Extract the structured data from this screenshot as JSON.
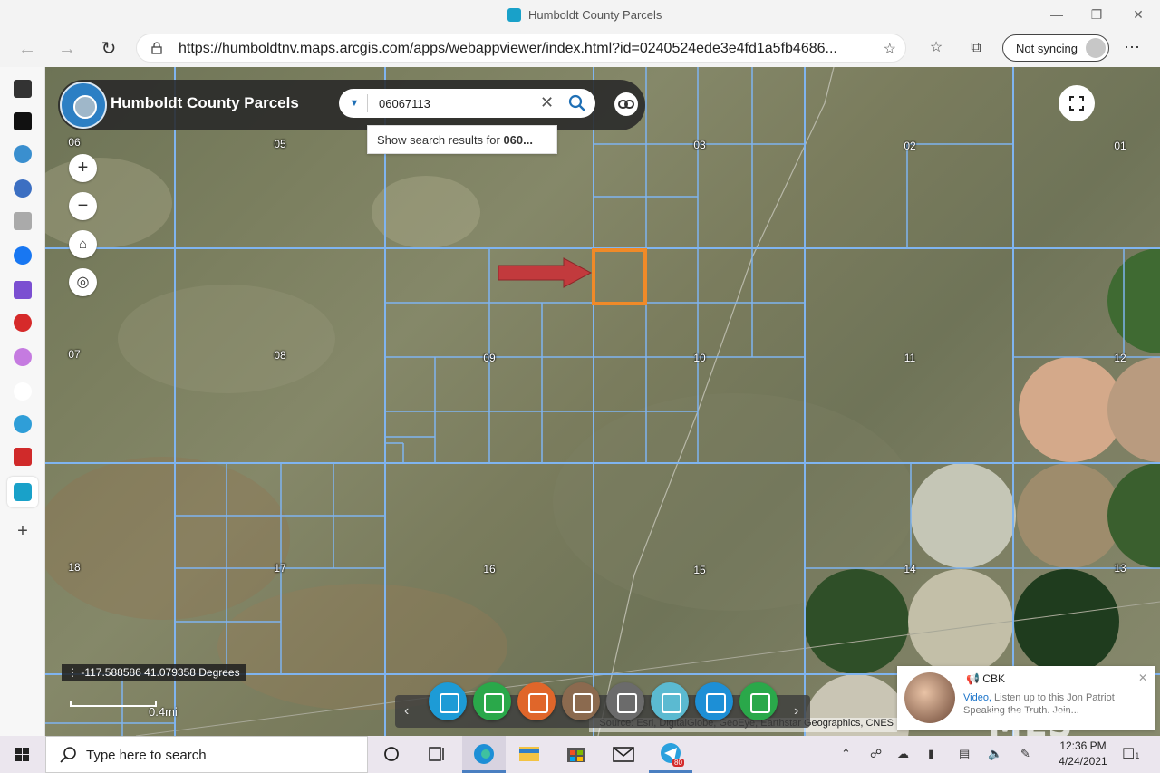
{
  "window": {
    "title": "Humboldt County Parcels",
    "controls": [
      "minimize",
      "maximize",
      "close"
    ]
  },
  "browser": {
    "url": "https://humboldtnv.maps.arcgis.com/apps/webappviewer/index.html?id=0240524ede3e4fd1a5fb4686...",
    "sync_label": "Not syncing"
  },
  "app": {
    "title": "Humboldt County Parcels",
    "search_value": "06067113",
    "suggestion_prefix": "Show search results for ",
    "suggestion_term": "060...",
    "coordinates": "-117.588586 41.079358 Degrees",
    "scale_label": "0.4mi",
    "attribution": "Source: Esri, DigitalGlobe, GeoEye, Earthstar Geographics, CNES"
  },
  "sections": [
    "06",
    "05",
    "03",
    "02",
    "01",
    "07",
    "08",
    "09",
    "10",
    "11",
    "12",
    "18",
    "17",
    "16",
    "15",
    "14",
    "13"
  ],
  "widgets": [
    "layers-icon",
    "basemap-gallery-icon",
    "attribute-table-icon",
    "query-icon",
    "select-icon",
    "measure-icon",
    "draw-icon",
    "print-icon"
  ],
  "widget_colors": [
    "#1d9bd6",
    "#2aa84a",
    "#e0662a",
    "#8b6a4f",
    "#6b6b6b",
    "#5bbad1",
    "#1d8fd6",
    "#2aa84a"
  ],
  "notification": {
    "sender": "CBK",
    "link": "Video,",
    "text": " Listen up to this Jon Patriot Speaking the Truth. Join..."
  },
  "watermark": "MLS",
  "taskbar": {
    "search_placeholder": "Type here to search",
    "telegram_badge": "80",
    "time": "12:36 PM",
    "date": "4/24/2021",
    "notifications_count": "1"
  }
}
